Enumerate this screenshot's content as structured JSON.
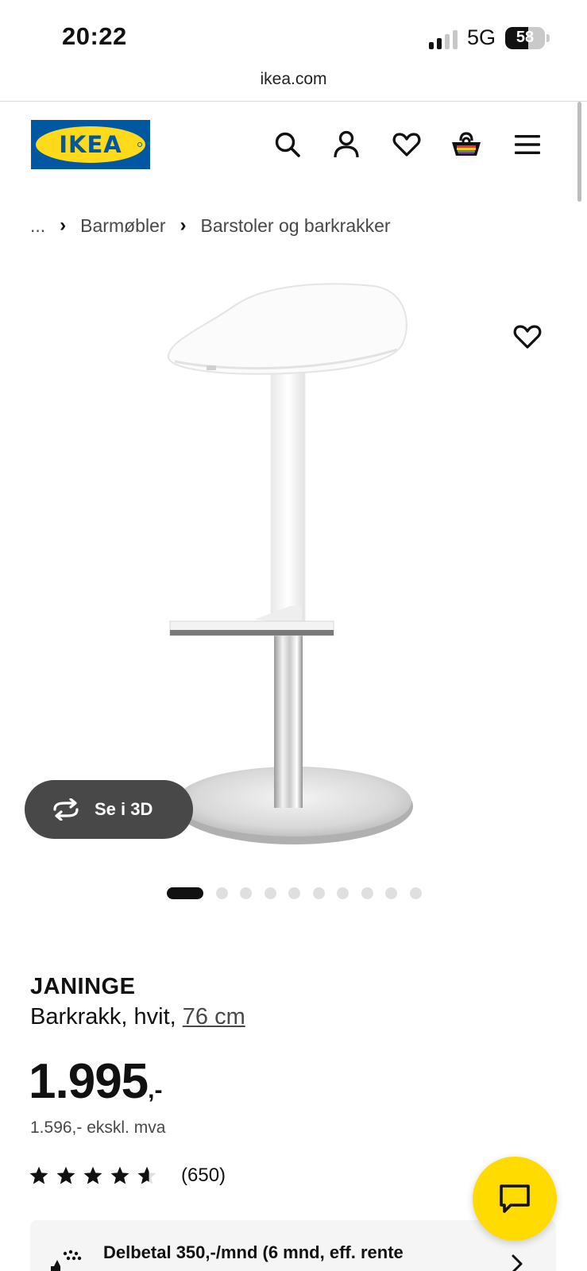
{
  "status_bar": {
    "time": "20:22",
    "network": "5G",
    "battery_percent": "58",
    "battery_level": 0.58
  },
  "browser": {
    "url": "ikea.com"
  },
  "header": {
    "logo_text": "IKEA",
    "icons": [
      "search-icon",
      "account-icon",
      "favourites-icon",
      "cart-icon",
      "menu-icon"
    ]
  },
  "breadcrumb": {
    "items": [
      "...",
      "Barmøbler",
      "Barstoler og barkrakker"
    ]
  },
  "gallery": {
    "view_3d_label": "Se i 3D",
    "image_count": 10,
    "active_index": 0
  },
  "product": {
    "name": "JANINGE",
    "description": "Barkrakk, hvit, ",
    "size": "76 cm",
    "price": "1.995",
    "price_suffix": ",-",
    "price_ex_vat": "1.596,- ekskl. mva",
    "rating": 4.6,
    "rating_max": 5,
    "review_count": "(650)"
  },
  "finance": {
    "text": "Delbetal 350,-/mnd (6 mnd, eff. rente"
  },
  "colors": {
    "ikea_blue": "#0058a3",
    "ikea_yellow": "#ffda1a",
    "chat_yellow": "#ffdb00",
    "dark_grey": "#484848"
  }
}
